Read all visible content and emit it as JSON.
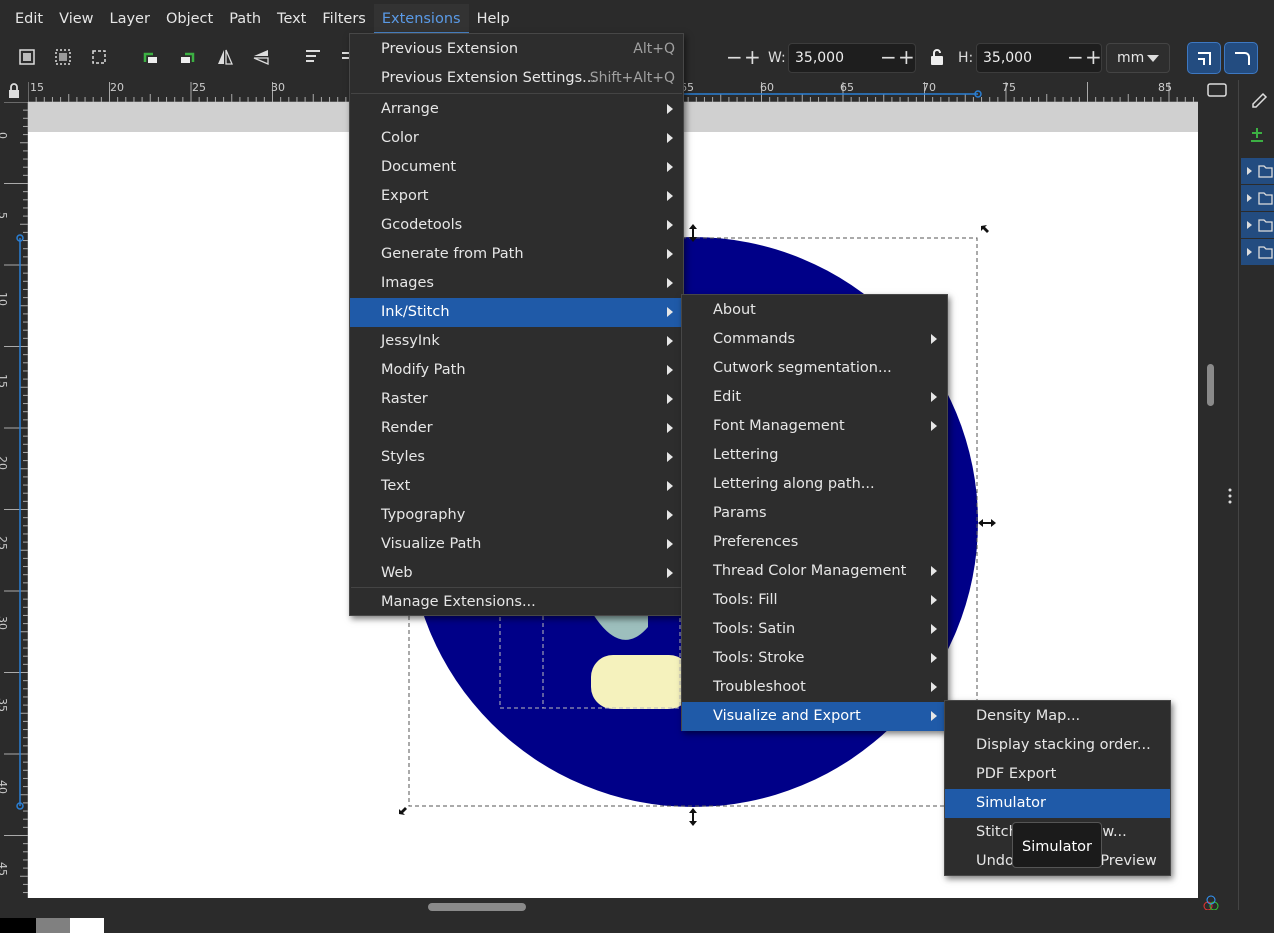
{
  "menubar": [
    "Edit",
    "View",
    "Layer",
    "Object",
    "Path",
    "Text",
    "Filters",
    "Extensions",
    "Help"
  ],
  "toolbar": {
    "w_label": "W:",
    "w_value": "35,000",
    "h_label": "H:",
    "h_value": "35,000",
    "unit": "mm"
  },
  "ruler": {
    "h_ticks": [
      "15",
      "20",
      "25",
      "30",
      "65",
      "60",
      "65",
      "70",
      "75",
      "85"
    ],
    "v_ticks": [
      "0",
      "5",
      "10",
      "15",
      "20",
      "25",
      "30",
      "35",
      "40",
      "45"
    ]
  },
  "extensions_menu": {
    "top": [
      {
        "label": "Previous Extension",
        "shortcut": "Alt+Q"
      },
      {
        "label": "Previous Extension Settings...",
        "shortcut": "Shift+Alt+Q"
      }
    ],
    "items": [
      "Arrange",
      "Color",
      "Document",
      "Export",
      "Gcodetools",
      "Generate from Path",
      "Images",
      "Ink/Stitch",
      "JessyInk",
      "Modify Path",
      "Raster",
      "Render",
      "Styles",
      "Text",
      "Typography",
      "Visualize Path",
      "Web"
    ],
    "bottom": "Manage Extensions..."
  },
  "inkstitch_menu": {
    "items": [
      "About",
      "Commands",
      "Cutwork segmentation...",
      "Edit",
      "Font Management",
      "Lettering",
      "Lettering along path...",
      "Params",
      "Preferences",
      "Thread Color Management",
      "Tools: Fill",
      "Tools: Satin",
      "Tools: Stroke",
      "Troubleshoot",
      "Visualize and Export"
    ]
  },
  "visualize_menu": {
    "items": [
      "Density Map...",
      "Display stacking order...",
      "PDF Export",
      "Simulator",
      "Stitch Plan Preview...",
      "Undo Stitch Plan Preview"
    ]
  },
  "tooltip": "Simulator",
  "colors": {
    "circle": "#000088",
    "highlight": "#1f5aa8",
    "accent_blue": "#2a7fd4",
    "yellow_shape": "#f5f2bd",
    "teal_shape": "#9dbfbd"
  }
}
